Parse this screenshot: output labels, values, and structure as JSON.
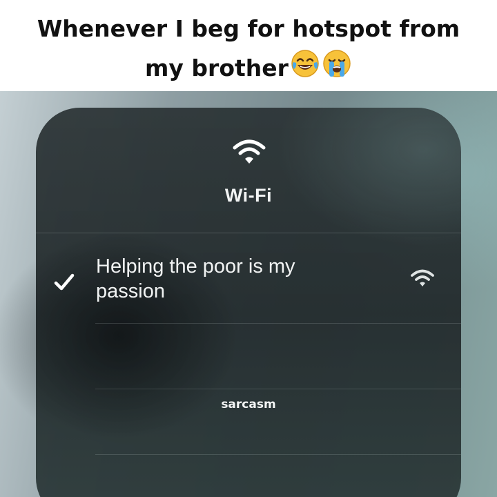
{
  "caption": {
    "line1": "Whenever I beg for hotspot from",
    "line2": "my brother",
    "emojis": [
      "face-with-tears-of-joy-emoji",
      "loudly-crying-face-emoji"
    ]
  },
  "wifi_panel": {
    "header_icon": "wifi-icon",
    "title": "Wi-Fi",
    "connected_network": {
      "name": "Helping the poor is my passion",
      "check_icon": "checkmark-icon",
      "signal_icon": "wifi-signal-icon"
    },
    "other_networks": [
      {
        "name": ""
      },
      {
        "name": "sarcasm"
      }
    ]
  },
  "colors": {
    "panel_text": "#f1f3f3",
    "caption_text": "#111111",
    "emoji_yellow": "#f7c23a",
    "tear_blue": "#4aa8e8"
  }
}
